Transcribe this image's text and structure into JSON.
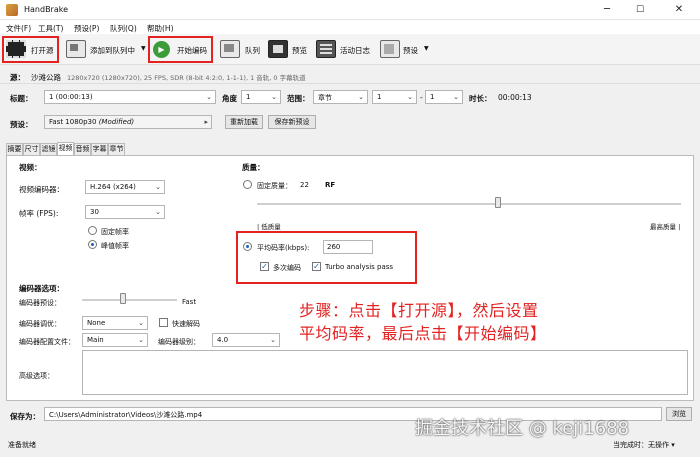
{
  "window": {
    "title": "HandBrake",
    "minimize": "─",
    "maximize": "☐",
    "close": "✕"
  },
  "menu": [
    "文件(F)",
    "工具(T)",
    "预设(P)",
    "队列(Q)",
    "帮助(H)"
  ],
  "toolbar": {
    "open_source": "打开源",
    "add_queue": "添加到队列中",
    "start": "开始编码",
    "queue": "队列",
    "preview": "预览",
    "activity": "活动日志",
    "presets": "预设"
  },
  "source": {
    "label": "源：",
    "name": "沙滩公路",
    "info": "1280x720 (1280x720), 25 FPS, SDR (8-bit 4:2:0, 1-1-1), 1 音轨, 0 字幕轨道"
  },
  "title_row": {
    "title_label": "标题：",
    "title_value": "1 (00:00:13)",
    "angle_label": "角度",
    "angle_value": "1",
    "range_label": "范围：",
    "range_type": "章节",
    "range_from": "1",
    "dash": "-",
    "range_to": "1",
    "duration_label": "时长：",
    "duration_value": "00:00:13"
  },
  "preset_row": {
    "label": "预设：",
    "value": "Fast 1080p30",
    "modified": "(Modified)",
    "reload": "重新加载",
    "save_new": "保存新预设"
  },
  "tabs": [
    "摘要",
    "尺寸",
    "滤镜",
    "视频",
    "音频",
    "字幕",
    "章节"
  ],
  "video": {
    "heading": "视频：",
    "encoder_label": "视频编码器：",
    "encoder_value": "H.264 (x264)",
    "fps_label": "帧率 (FPS):",
    "fps_value": "30",
    "constant_fps": "固定帧率",
    "peak_fps": "峰值帧率"
  },
  "quality": {
    "heading": "质量：",
    "constant_quality": "固定质量：",
    "cq_value": "22",
    "rf": "RF",
    "low": "| 低质量",
    "high": "最高质量 |",
    "avg_bitrate": "平均码率(kbps):",
    "bitrate_value": "260",
    "multipass": "多次编码",
    "turbo": "Turbo analysis pass"
  },
  "encoder_opts": {
    "heading": "编码器选项：",
    "preset_label": "编码器预设：",
    "preset_speed": "Fast",
    "tune_label": "编码器调优：",
    "tune_value": "None",
    "fast_decode": "快速解码",
    "profile_label": "编码器配置文件：",
    "profile_value": "Main",
    "level_label": "编码器级别：",
    "level_value": "4.0",
    "advanced_label": "高级选项："
  },
  "save": {
    "label": "保存为：",
    "path": "C:\\Users\\Administrator\\Videos\\沙滩公路.mp4",
    "browse": "浏览"
  },
  "status": {
    "left": "准备就绪",
    "when_done_label": "当完成时：",
    "when_done_value": "无操作"
  },
  "annotation": {
    "line1": "步骤：点击【打开源】，然后设置",
    "line2": "平均码率，最后点击【开始编码】"
  },
  "watermark": "掘金技术社区 @ keji1688",
  "colors": {
    "highlight": "#e32222",
    "accent": "#1d63b7"
  }
}
